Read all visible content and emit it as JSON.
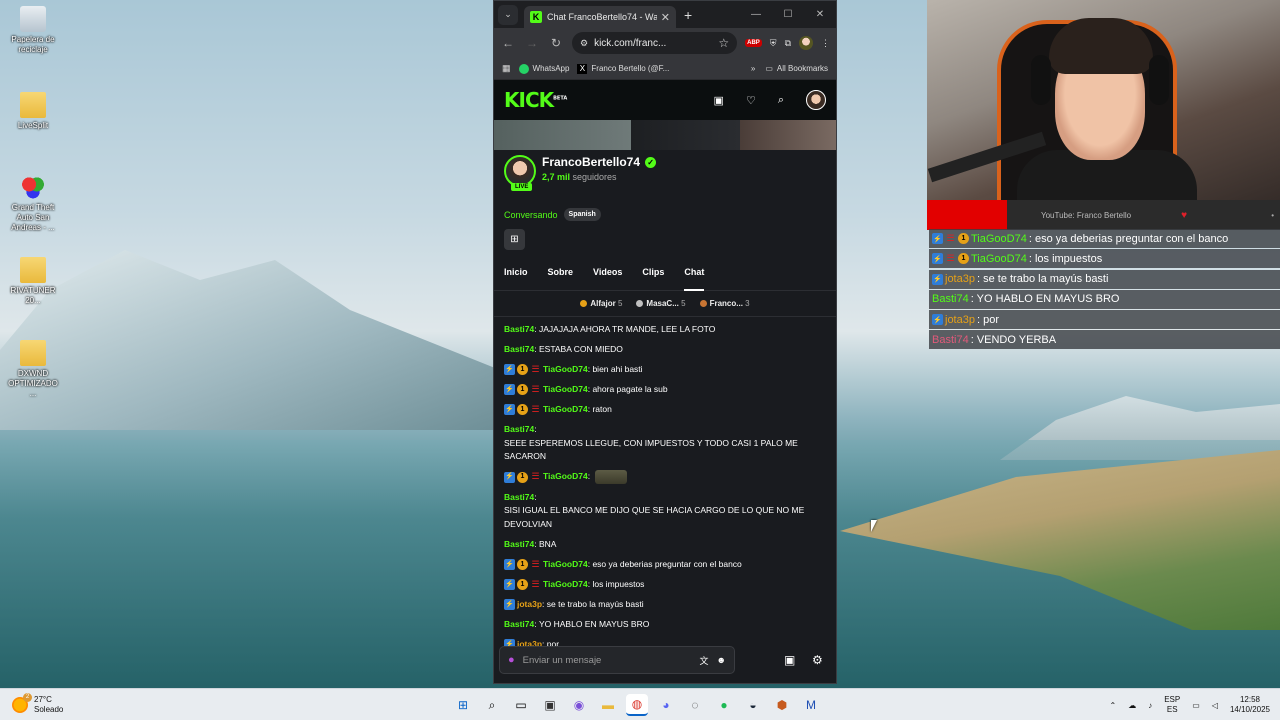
{
  "desktop": {
    "icons": [
      {
        "label": "Papelera de reciclaje"
      },
      {
        "label": "LiveSplit"
      },
      {
        "label": "Grand Theft Auto San Andreas - ..."
      },
      {
        "label": "RIVATUNER 20..."
      },
      {
        "label": "DXWND OPTIMIZADO ..."
      }
    ]
  },
  "browser": {
    "tab_title": "Chat FrancoBertello74 - Watch",
    "tab_favicon": "K",
    "url": "kick.com/franc...",
    "bookmarks": [
      {
        "label": "WhatsApp"
      },
      {
        "label": "Franco Bertello (@F..."
      }
    ],
    "bookmarks_more": "»",
    "all_bookmarks": "All Bookmarks",
    "abp_label": "ABP"
  },
  "kick": {
    "logo": "KICK",
    "logo_sup": "BETA",
    "channel_name": "FrancoBertello74",
    "followers_count": "2,7 mil",
    "followers_label": "seguidores",
    "live_label": "LIVE",
    "category": "Conversando",
    "language": "Spanish",
    "tabs": [
      "Inicio",
      "Sobre",
      "Videos",
      "Clips",
      "Chat"
    ],
    "active_tab": "Chat",
    "leaderboard": [
      {
        "user": "Alfajor",
        "count": "5",
        "color": "#e6a117"
      },
      {
        "user": "MasaC...",
        "count": "5",
        "color": "#c0c0c0"
      },
      {
        "user": "Franco...",
        "count": "3",
        "color": "#c87533"
      }
    ],
    "chat_messages": [
      {
        "user": "Basti74",
        "text": "JAJAJAJA AHORA TR MANDE, LEE LA FOTO",
        "color": "#53fc18",
        "badges": false
      },
      {
        "user": "Basti74",
        "text": "ESTABA CON MIEDO",
        "color": "#53fc18",
        "badges": false
      },
      {
        "user": "TiaGooD74",
        "text": "bien ahi basti",
        "color": "#53fc18",
        "badges": true
      },
      {
        "user": "TiaGooD74",
        "text": "ahora pagate la sub",
        "color": "#53fc18",
        "badges": true
      },
      {
        "user": "TiaGooD74",
        "text": "raton",
        "color": "#53fc18",
        "badges": true
      },
      {
        "user": "Basti74",
        "text": "SEEE ESPEREMOS LLEGUE, CON IMPUESTOS Y TODO CASI 1 PALO ME SACARON",
        "color": "#53fc18",
        "badges": false
      },
      {
        "user": "TiaGooD74",
        "text": "",
        "color": "#53fc18",
        "badges": true,
        "emote": true
      },
      {
        "user": "Basti74",
        "text": "SISI IGUAL EL BANCO ME DIJO QUE SE HACIA CARGO DE LO QUE NO ME DEVOLVIAN",
        "color": "#53fc18",
        "badges": false
      },
      {
        "user": "Basti74",
        "text": "BNA",
        "color": "#53fc18",
        "badges": false
      },
      {
        "user": "TiaGooD74",
        "text": "eso ya deberias preguntar con el banco",
        "color": "#53fc18",
        "badges": true
      },
      {
        "user": "TiaGooD74",
        "text": "los impuestos",
        "color": "#53fc18",
        "badges": true
      },
      {
        "user": "jota3p",
        "text": "se te trabo la mayús basti",
        "color": "#e6a117",
        "badges": "pin"
      },
      {
        "user": "Basti74",
        "text": "YO HABLO EN MAYUS BRO",
        "color": "#53fc18",
        "badges": false
      },
      {
        "user": "jota3p",
        "text": "por",
        "color": "#e6a117",
        "badges": "pin"
      },
      {
        "user": "Basti74",
        "text": "VENDO YERBA",
        "color": "#e05a7a",
        "badges": false
      }
    ],
    "chat_placeholder": "Enviar un mensaje"
  },
  "webcam": {
    "footer_text": "YouTube: Franco Bertello"
  },
  "overlay_chat": [
    {
      "user": "TiaGooD74",
      "text": ": eso ya deberias preguntar con el banco",
      "color": "#53fc18",
      "badges": true
    },
    {
      "user": "TiaGooD74",
      "text": ": los impuestos",
      "color": "#53fc18",
      "badges": true
    },
    {
      "user": "jota3p",
      "text": ": se te trabo la mayús basti",
      "color": "#e6a117",
      "badges": "pin"
    },
    {
      "user": "Basti74",
      "text": ": YO HABLO EN MAYUS BRO",
      "color": "#53fc18",
      "badges": false
    },
    {
      "user": "jota3p",
      "text": ": por",
      "color": "#e6a117",
      "badges": "pin"
    },
    {
      "user": "Basti74",
      "text": ": VENDO YERBA",
      "color": "#e05a7a",
      "badges": false
    }
  ],
  "taskbar": {
    "weather_temp": "27°C",
    "weather_desc": "Soleado",
    "weather_badge": "2",
    "lang_top": "ESP",
    "lang_bottom": "ES",
    "time": "12:58",
    "date": "14/10/2025"
  }
}
